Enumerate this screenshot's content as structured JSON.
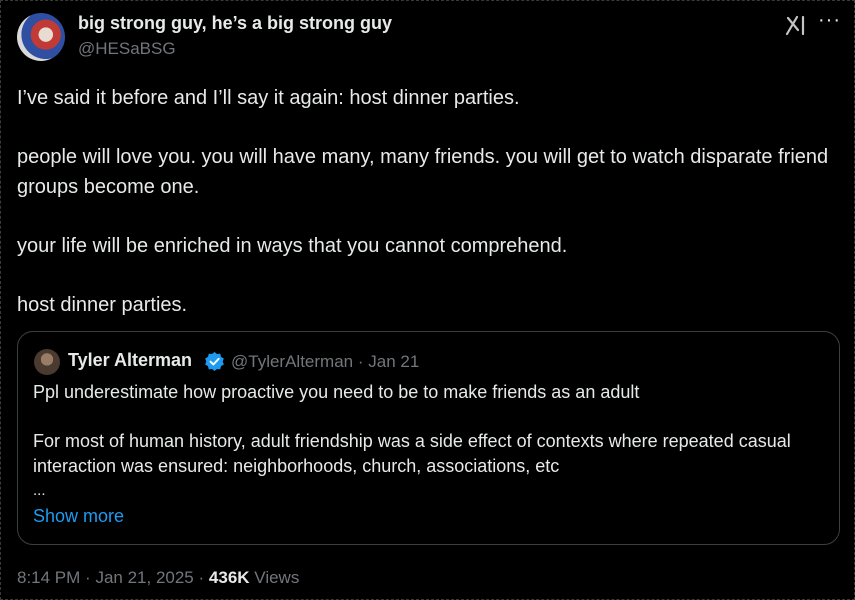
{
  "author": {
    "name": "big strong guy, he’s a big strong guy",
    "handle": "@HESaBSG"
  },
  "header_icons": [
    "grok-icon",
    "more-icon"
  ],
  "more_glyph": "···",
  "tweet": {
    "paragraphs": [
      "I’ve said it before and I’ll say it again: host dinner parties.",
      "people will love you. you will have many, many friends. you will get to watch disparate friend groups become one.",
      "your life will be enriched in ways that you cannot comprehend.",
      "host dinner parties."
    ]
  },
  "quote": {
    "name": "Tyler Alterman",
    "handle": "@TylerAlterman",
    "separator": "·",
    "date": "Jan 21",
    "verified": true,
    "paragraph1": "Ppl underestimate how proactive you need to be to make friends as an adult",
    "paragraph2": "For most of human history, adult friendship was a side effect of contexts where repeated casual interaction was ensured: neighborhoods, church, associations, etc",
    "ellipsis": "...",
    "show_more": "Show more"
  },
  "meta": {
    "time": "8:14 PM",
    "separator": "·",
    "date": "Jan 21, 2025",
    "views_count": "436K",
    "views_label": "Views"
  },
  "colors": {
    "background": "#000000",
    "text": "#e7e9ea",
    "muted": "#71767b",
    "link": "#1d9bf0",
    "verified": "#1d9bf0",
    "border": "#3a3f44"
  }
}
